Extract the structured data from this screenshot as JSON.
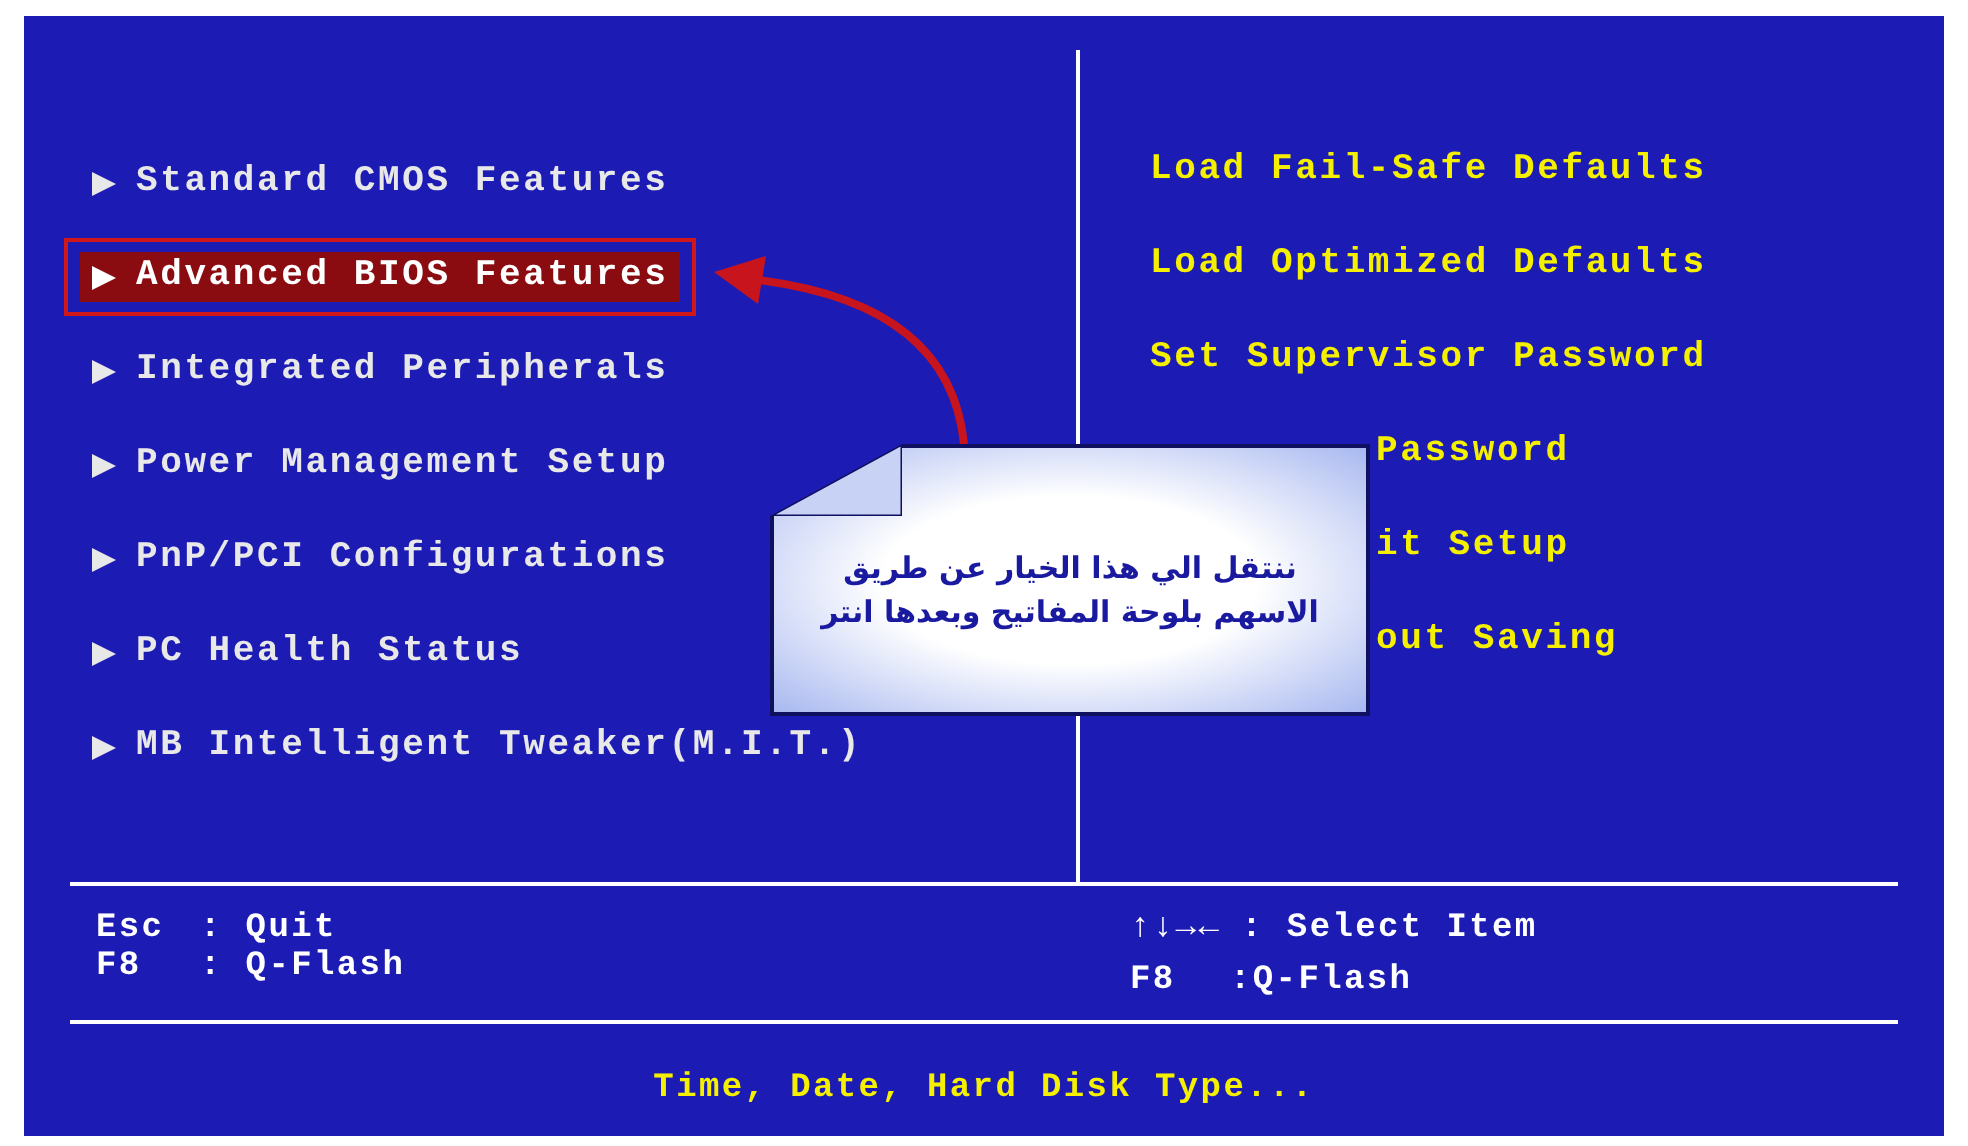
{
  "main_menu": {
    "left_items": [
      {
        "label": "Standard CMOS Features",
        "selected": false
      },
      {
        "label": "Advanced BIOS Features",
        "selected": true
      },
      {
        "label": "Integrated Peripherals",
        "selected": false
      },
      {
        "label": "Power Management Setup",
        "selected": false
      },
      {
        "label": "PnP/PCI Configurations",
        "selected": false
      },
      {
        "label": "PC Health Status",
        "selected": false
      },
      {
        "label": "MB Intelligent Tweaker(M.I.T.)",
        "selected": false
      }
    ],
    "right_items": [
      {
        "label": "Load Fail-Safe Defaults",
        "kind": "full"
      },
      {
        "label": "Load Optimized Defaults",
        "kind": "full"
      },
      {
        "label": "Set Supervisor Password",
        "kind": "full"
      },
      {
        "label": "Password",
        "kind": "partial"
      },
      {
        "label": "it Setup",
        "kind": "partial"
      },
      {
        "label": "out Saving",
        "kind": "partial"
      }
    ]
  },
  "key_help": {
    "left": [
      {
        "key": "Esc",
        "action": ": Quit"
      },
      {
        "key": "F8",
        "action": ": Q-Flash"
      }
    ],
    "right": [
      {
        "key": "↑↓→←",
        "action": ": Select Item"
      },
      {
        "key": "F8",
        "action": ":Q-Flash"
      }
    ]
  },
  "status_line": "Time, Date, Hard Disk Type...",
  "annotation": {
    "lines": [
      "ننتقل الي هذا الخيار عن طريق",
      "الاسهم بلوحة المفاتيح وبعدها انتر"
    ]
  }
}
